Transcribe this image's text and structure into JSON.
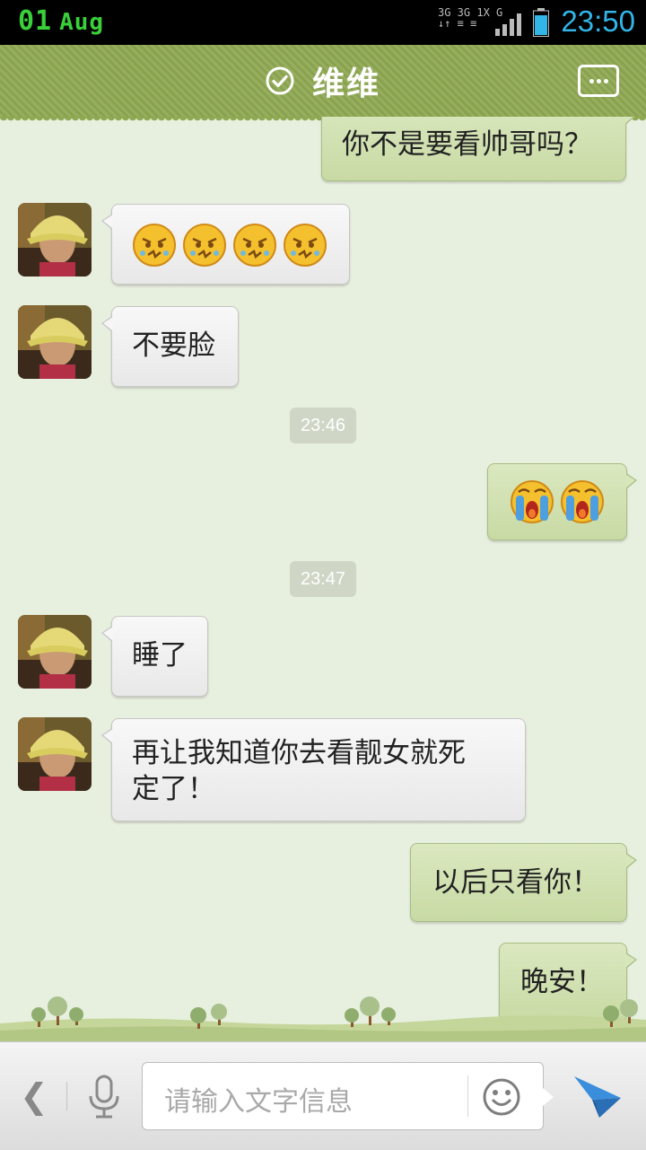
{
  "status_bar": {
    "date_day": "01",
    "date_month": "Aug",
    "network_row1": "3G 3G 1X  G",
    "network_row2": "↓↑ ≡  ≡",
    "time": "23:50",
    "battery_color": "#31b6e7"
  },
  "header": {
    "title": "维维",
    "verified_icon": "check-circle-icon",
    "more_icon": "more-dots-icon",
    "bg_color": "#8fa953"
  },
  "messages": [
    {
      "side": "right",
      "type": "text",
      "text": "你不是要看帅哥吗？"
    },
    {
      "side": "left",
      "type": "emoji",
      "emoji": "grumpy-face-emoji",
      "count": 4
    },
    {
      "side": "left",
      "type": "text",
      "text": "不要脸"
    },
    {
      "type": "timestamp",
      "text": "23:46"
    },
    {
      "side": "right",
      "type": "emoji",
      "emoji": "crying-face-emoji",
      "count": 2
    },
    {
      "type": "timestamp",
      "text": "23:47"
    },
    {
      "side": "left",
      "type": "text",
      "text": "睡了"
    },
    {
      "side": "left",
      "type": "text",
      "line1": "再让我知道你去看靓女就死",
      "line2": "定了！"
    },
    {
      "side": "right",
      "type": "text",
      "text": "以后只看你！"
    },
    {
      "side": "right",
      "type": "text",
      "text": "晚安！"
    }
  ],
  "input_bar": {
    "back_glyph": "❮",
    "placeholder": "请输入文字信息",
    "voice_icon": "microphone-icon",
    "emoji_icon": "smiley-icon",
    "send_icon": "send-icon"
  }
}
